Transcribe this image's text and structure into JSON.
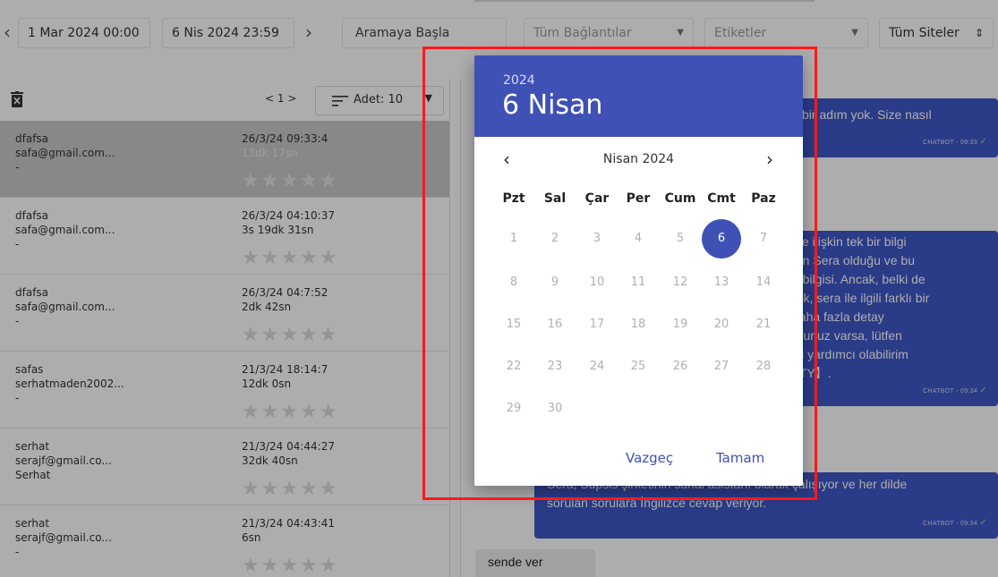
{
  "filters": {
    "prev_icon": "chevron-left-icon",
    "start_date": "1 Mar 2024 00:00",
    "end_date": "6 Nis 2024 23:59",
    "next_icon": "chevron-right-icon",
    "search_label": "Aramaya Başla",
    "connections": "Tüm Bağlantılar",
    "tags": "Etiketler",
    "sites": "Tüm Siteler"
  },
  "list": {
    "delete_icon": "trash-icon",
    "pager": "< 1 >",
    "count_label": "Adet: 10",
    "rows": [
      {
        "name": "dfafsa",
        "email": "safa@gmail.com...",
        "tag": "-",
        "date": "26/3/24 09:33:4",
        "duration": "13dk 17sn",
        "selected": true
      },
      {
        "name": "dfafsa",
        "email": "safa@gmail.com...",
        "tag": "-",
        "date": "26/3/24 04:10:37",
        "duration": "3s 19dk 31sn"
      },
      {
        "name": "dfafsa",
        "email": "safa@gmail.com...",
        "tag": "-",
        "date": "26/3/24 04:7:52",
        "duration": "2dk 42sn"
      },
      {
        "name": "safas",
        "email": "serhatmaden2002...",
        "tag": "-",
        "date": "21/3/24 18:14:7",
        "duration": "12dk 0sn"
      },
      {
        "name": "serhat",
        "email": "serajf@gmail.co...",
        "tag": "Serhat",
        "date": "21/3/24 04:44:27",
        "duration": "32dk 40sn"
      },
      {
        "name": "serhat",
        "email": "serajf@gmail.co...",
        "tag": "-",
        "date": "21/3/24 04:43:41",
        "duration": "6sn"
      }
    ],
    "stars": "★★★★★"
  },
  "chat": {
    "bubble1": {
      "text": "l bir adım yok. Size nasıl",
      "meta": "CHATBOT - 09:33"
    },
    "bubble2": {
      "lines": [
        "ine ilişkin tek bir bilgi",
        "nın Sera olduğu ve bu",
        "u bilgisi. Ancak, belki de",
        "rek, sera ile ilgili farklı bir",
        "daha fazla detay",
        "orunuz varsa, lütfen",
        "iyi yardımcı olabilirim",
        "5TY】."
      ],
      "meta": "CHATBOT - 09:34"
    },
    "bubble3": {
      "lines": [
        "Sera, Supsis şirketinin sanal asistanı olarak çalışıyor ve her dilde",
        "sorulan sorulara İngilizce cevap veriyor."
      ],
      "meta": "CHATBOT - 09:34"
    },
    "user_msg": "sende ver"
  },
  "picker": {
    "year": "2024",
    "selected_label": "6 Nisan",
    "month_label": "Nisan 2024",
    "prev_icon": "chevron-left-icon",
    "next_icon": "chevron-right-icon",
    "weekdays": [
      "Pzt",
      "Sal",
      "Çar",
      "Per",
      "Cum",
      "Cmt",
      "Paz"
    ],
    "first_weekday_index": 0,
    "days_in_month": 30,
    "selected_day": 6,
    "cancel_label": "Vazgeç",
    "ok_label": "Tamam"
  },
  "colors": {
    "primary": "#3f51b5",
    "chatbot_bubble": "#3f58c7",
    "annotation": "#ff1a1a"
  }
}
